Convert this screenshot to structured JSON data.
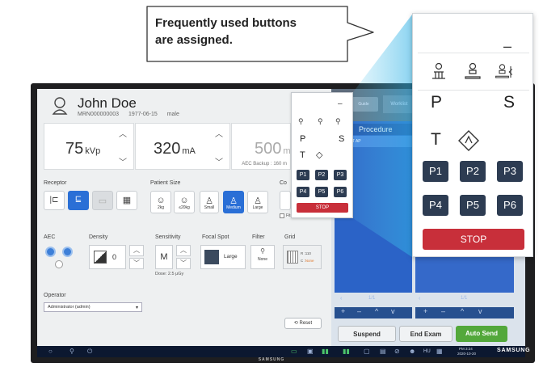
{
  "callout": {
    "line1": "Frequently used buttons",
    "line2": "are assigned."
  },
  "patient": {
    "name": "John Doe",
    "mrn": "MRN000000003",
    "dob": "1977-06-15",
    "sex": "male"
  },
  "exposure": {
    "kv_value": "75",
    "kv_unit": "kVp",
    "ma_value": "320",
    "ma_unit": "mA",
    "mas_value": "500",
    "mas_unit": "m",
    "aec_backup": "AEC Backup : 160 m"
  },
  "receptor": {
    "label": "Receptor"
  },
  "patient_size": {
    "label": "Patient Size",
    "options": [
      "2kg",
      "≤20kg",
      "Small",
      "Medium",
      "Large"
    ],
    "selected": "Medium"
  },
  "collimator": {
    "label": "Co",
    "checkbox_label": "Fit-ra..."
  },
  "aec": {
    "label": "AEC"
  },
  "density": {
    "label": "Density",
    "value": "0"
  },
  "sensitivity": {
    "label": "Sensitivity",
    "value": "M",
    "dose": "Dose: 2.5 μGy"
  },
  "focal_spot": {
    "label": "Focal Spot",
    "value": "Large"
  },
  "filter": {
    "label": "Filter",
    "value": "None"
  },
  "grid": {
    "label": "Grid",
    "r_value": "R :110",
    "c_label": "C :",
    "c_value": "None"
  },
  "operator": {
    "label": "Operator",
    "value": "Administrator (admin)"
  },
  "reset_label": "Reset",
  "right_panel": {
    "tab1": "Guide",
    "tab2": "Worklist",
    "procedure_header": "Procedure",
    "procedure_item": "CHEST AP",
    "page_left": "1/1",
    "page_right": "1/1"
  },
  "actions": {
    "suspend": "Suspend",
    "end_exam": "End Exam",
    "auto_send": "Auto Send"
  },
  "quick_panel": {
    "minimize": "–",
    "p_label": "P",
    "s_label": "S",
    "t_label": "T",
    "presets": [
      "P1",
      "P2",
      "P3",
      "P4",
      "P5",
      "P6"
    ],
    "stop": "STOP"
  },
  "taskbar": {
    "hu_label": "HU",
    "time": "PM 3:24",
    "date": "2020-10-20",
    "brand": "SAMSUNG"
  },
  "bezel_brand": "SAMSUNG",
  "colors": {
    "accent_blue": "#2a6fd6",
    "stop_red": "#c82f3a",
    "preset_navy": "#2d3c52",
    "send_green": "#53a83b"
  }
}
